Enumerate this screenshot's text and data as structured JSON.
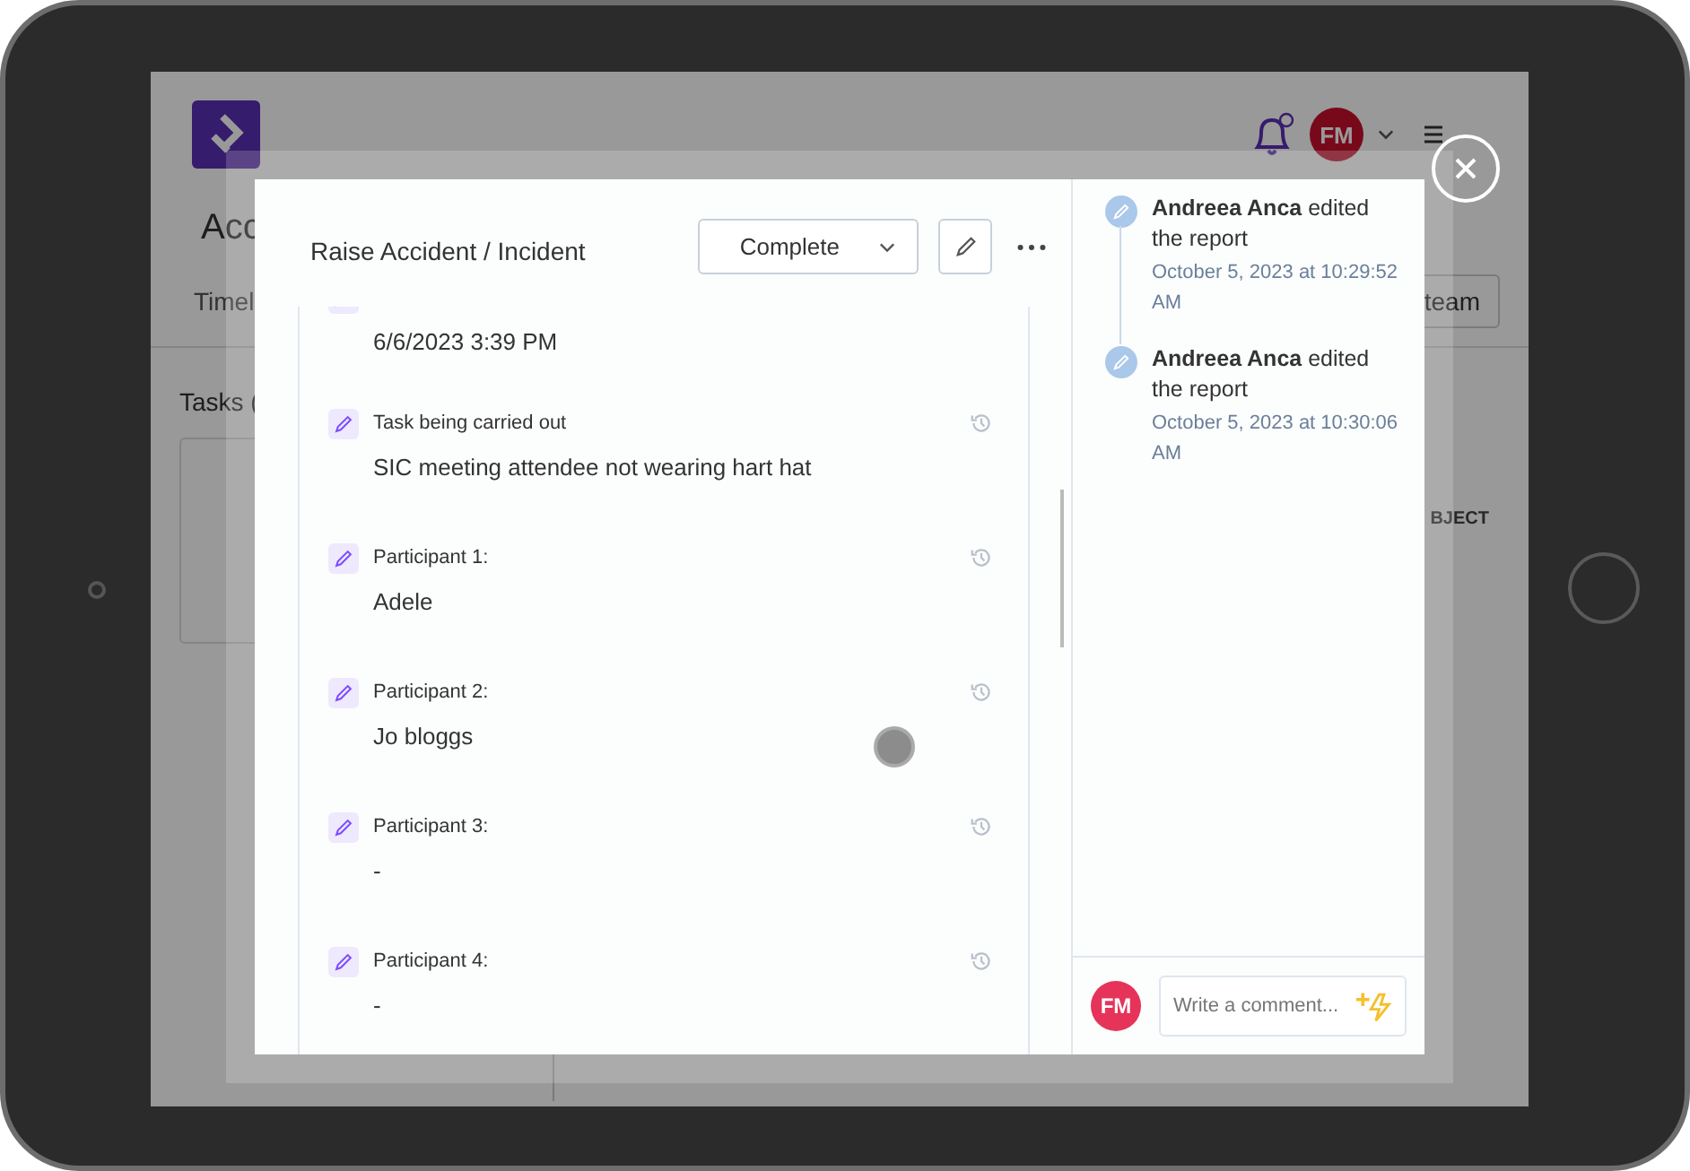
{
  "page": {
    "title": "Acc",
    "tab": "Timel",
    "tasks_heading": "Tasks (",
    "team_button": "team",
    "column_header": "BJECT",
    "user_initials": "FM"
  },
  "modal": {
    "title": "Raise Accident / Incident",
    "status": "Complete",
    "fields": [
      {
        "value": "6/6/2023 3:39 PM"
      },
      {
        "label": "Task being carried out",
        "value": "SIC meeting attendee not wearing hart hat"
      },
      {
        "label": "Participant 1:",
        "value": "Adele"
      },
      {
        "label": "Participant 2:",
        "value": "Jo bloggs"
      },
      {
        "label": "Participant 3:",
        "value": "-"
      },
      {
        "label": "Participant 4:",
        "value": "-"
      }
    ],
    "activity": [
      {
        "user": "Andreea Anca",
        "action": "edited the report",
        "time": "October 5, 2023 at 10:29:52 AM"
      },
      {
        "user": "Andreea Anca",
        "action": "edited the report",
        "time": "October 5, 2023 at 10:30:06 AM"
      }
    ],
    "comment": {
      "initials": "FM",
      "placeholder": "Write a comment..."
    }
  }
}
